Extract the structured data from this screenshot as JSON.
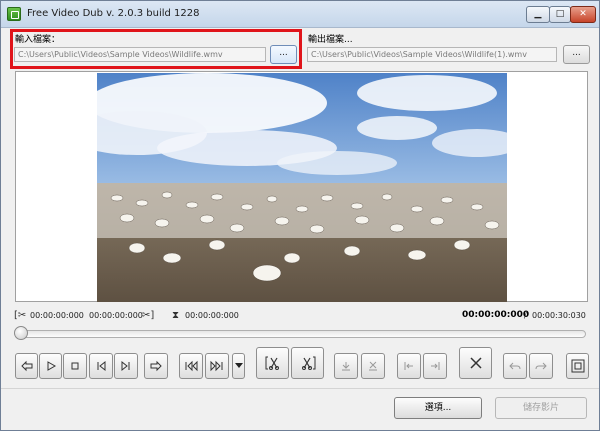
{
  "window": {
    "title": "Free Video Dub  v. 2.0.3 build 1228",
    "controls": {
      "minimize": "▁",
      "maximize": "□",
      "close": "✕"
    }
  },
  "input": {
    "label": "輸入檔案：",
    "path": "C:\\Users\\Public\\Videos\\Sample Videos\\Wildlife.wmv",
    "browse_label": "..."
  },
  "output": {
    "label": "輸出檔案...",
    "path": "C:\\Users\\Public\\Videos\\Sample Videos\\Wildlife(1).wmv",
    "browse_label": "..."
  },
  "markers": {
    "selection_start": "00:00:00:000",
    "selection_end": "00:00:00:000",
    "marker_time": "00:00:00:000"
  },
  "playback": {
    "current_time": "00:00:00:000",
    "separator": "/",
    "total_time": "00:00:30:030",
    "position_fraction": 0
  },
  "toolbar": {
    "icons": [
      "previous-frame-icon",
      "play-icon",
      "stop-icon",
      "previous-keyframe-icon",
      "next-keyframe-icon",
      "next-frame-icon",
      "skip-to-start-icon",
      "skip-to-end-icon",
      "dropdown-arrow-icon",
      "mark-start-icon",
      "mark-end-icon",
      "set-marker-icon",
      "clear-marker-icon",
      "jump-to-start-marker-icon",
      "jump-to-end-marker-icon",
      "delete-icon",
      "undo-icon",
      "redo-icon",
      "fullscreen-icon"
    ]
  },
  "buttons": {
    "options_label": "選項...",
    "save_label": "儲存影片"
  },
  "colors": {
    "highlight": "#e0141a",
    "sky": "#6f9bd1",
    "ground": "#7a6a55"
  }
}
